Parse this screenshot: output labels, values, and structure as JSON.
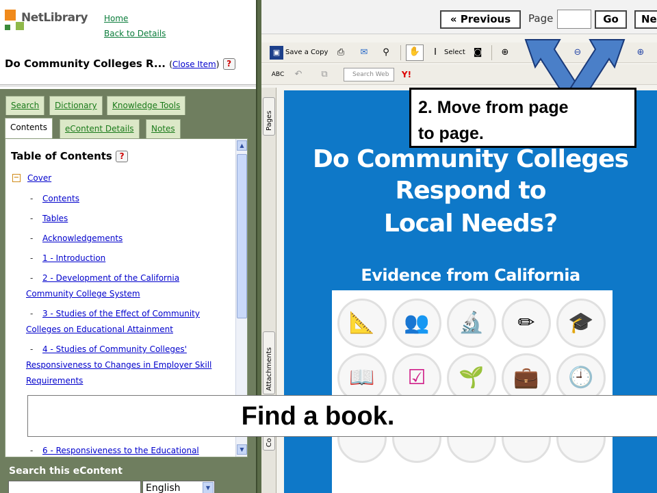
{
  "header": {
    "logo_text": "NetLibrary",
    "links": [
      "Home",
      "Back to Details"
    ],
    "item_title": "Do Community Colleges R...",
    "close_item": "Close Item",
    "help_mark": "?"
  },
  "tabs_row1": [
    "Search",
    "Dictionary",
    "Knowledge Tools"
  ],
  "tabs_row2": [
    "Contents",
    "eContent Details",
    "Notes"
  ],
  "toc": {
    "title": "Table of Contents",
    "items": [
      "Cover",
      "Contents",
      "Tables",
      "Acknowledgements",
      "1 - Introduction",
      "2 - Development of the California",
      "Community College System",
      "3 - Studies of the Effect of Community",
      "Colleges on Educational Attainment",
      "4 - Studies of Community Colleges'",
      "Responsiveness to Changes in Employer Skill",
      "Requirements",
      "6 - Responsiveness to the Educational"
    ]
  },
  "search": {
    "label": "Search this eContent",
    "language": "English"
  },
  "nav": {
    "previous": "« Previous",
    "page_label": "Page",
    "page_value": "",
    "go": "Go",
    "next": "Ne"
  },
  "toolbar": {
    "save_copy": "Save a Copy",
    "select": "Select",
    "search_web": "Search Web",
    "yahoo": "Y!"
  },
  "side_tabs": [
    "Pages",
    "Attachments",
    "Co"
  ],
  "cover": {
    "title_lines": [
      "Do Community Colleges",
      "Respond to",
      "Local Needs?"
    ],
    "subtitle": "Evidence from California",
    "icons": [
      "triangle-ruler-icon",
      "people-icon",
      "microscope-icon",
      "pencil-icon",
      "graduation-cap-icon",
      "book-icon",
      "checkbox-icon",
      "plant-icon",
      "briefcase-icon",
      "clock-icon"
    ]
  },
  "callout": {
    "line1": "2.  Move from page",
    "line2": "to page."
  },
  "banner": "Find a book.",
  "colors": {
    "accent_green": "#0a7c3a",
    "panel_green": "#6f7e5f",
    "cover_blue": "#0e78c8",
    "arrow_blue": "#4a7fc8"
  }
}
